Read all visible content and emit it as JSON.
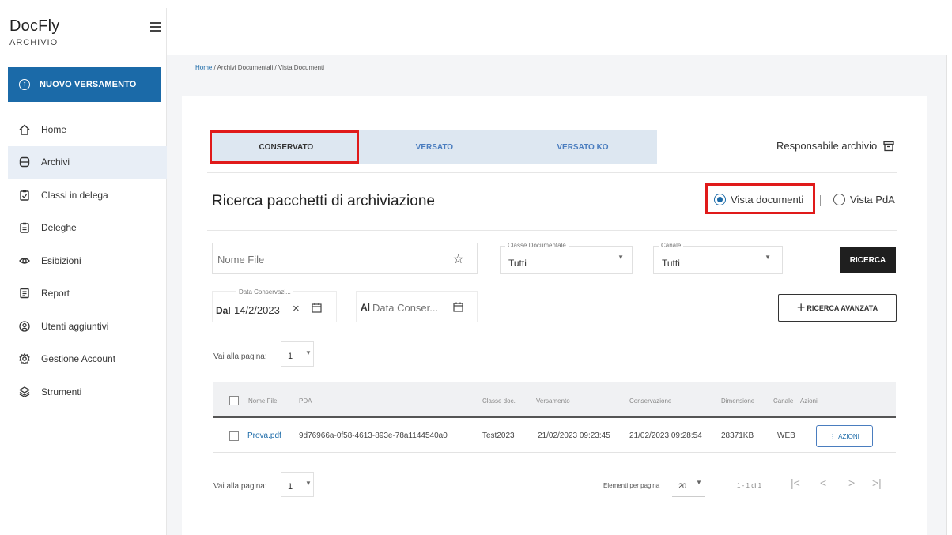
{
  "app": {
    "name": "DocFly",
    "subtitle": "ARCHIVIO"
  },
  "sidebar": {
    "new_button": "NUOVO VERSAMENTO",
    "items": [
      {
        "label": "Home",
        "icon": "home-icon"
      },
      {
        "label": "Archivi",
        "icon": "database-icon",
        "active": true
      },
      {
        "label": "Classi in delega",
        "icon": "clipboard-check-icon"
      },
      {
        "label": "Deleghe",
        "icon": "clipboard-list-icon"
      },
      {
        "label": "Esibizioni",
        "icon": "eye-icon"
      },
      {
        "label": "Report",
        "icon": "report-icon"
      },
      {
        "label": "Utenti aggiuntivi",
        "icon": "user-circle-icon"
      },
      {
        "label": "Gestione Account",
        "icon": "gear-icon"
      },
      {
        "label": "Strumenti",
        "icon": "layers-icon"
      }
    ]
  },
  "breadcrumb": {
    "home": "Home",
    "rest": " / Archivi Documentali / Vista Documenti"
  },
  "tabs": [
    "CONSERVATO",
    "VERSATO",
    "VERSATO KO"
  ],
  "active_tab": "CONSERVATO",
  "responsabile": "Responsabile archivio",
  "section_title": "Ricerca pacchetti di archiviazione",
  "view_options": {
    "documenti": "Vista documenti",
    "pda": "Vista PdA",
    "selected": "documenti"
  },
  "filters": {
    "nome_file_placeholder": "Nome File",
    "classe_label": "Classe Documentale",
    "classe_value": "Tutti",
    "canale_label": "Canale",
    "canale_value": "Tutti",
    "search_button": "RICERCA",
    "data_label": "Data Conservazi...",
    "dal_prefix": "Dal",
    "dal_value": "14/2/2023",
    "al_prefix": "Al",
    "al_placeholder": "Data Conser...",
    "advanced_button": "RICERCA AVANZATA"
  },
  "pager": {
    "goto_label": "Vai alla pagina:",
    "page": "1",
    "per_page_label": "Elementi per pagina",
    "per_page": "20",
    "range": "1 - 1 di 1"
  },
  "table": {
    "headers": [
      "Nome File",
      "PDA",
      "Classe doc.",
      "Versamento",
      "Conservazione",
      "Dimensione",
      "Canale",
      "Azioni"
    ],
    "rows": [
      {
        "nome_file": "Prova.pdf",
        "pda": "9d76966a-0f58-4613-893e-78a1144540a0",
        "classe": "Test2023",
        "versamento": "21/02/2023 09:23:45",
        "conservazione": "21/02/2023 09:28:54",
        "dimensione": "28371KB",
        "canale": "WEB",
        "azioni": "AZIONI"
      }
    ]
  },
  "colors": {
    "primary": "#1b6aa8",
    "highlight": "#e01a1a",
    "tab_bg": "#dde7f1",
    "active_nav": "#e8eef6"
  }
}
